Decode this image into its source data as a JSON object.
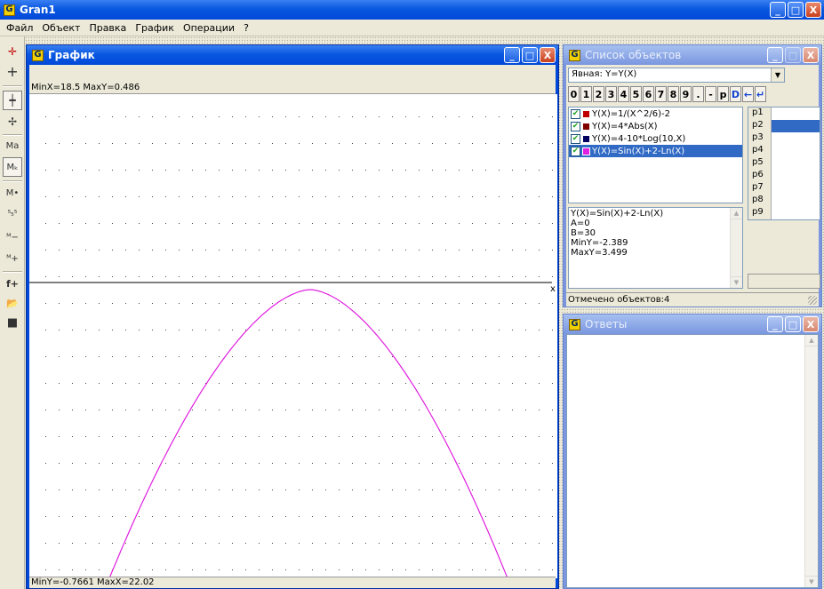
{
  "app": {
    "title": "Gran1"
  },
  "menu": [
    "Файл",
    "Объект",
    "Правка",
    "График",
    "Операции",
    "?"
  ],
  "window_buttons": {
    "minimize": "_",
    "maximize": "□",
    "close": "X"
  },
  "toolbar": {
    "items": [
      {
        "name": "axes-red-icon",
        "glyph": "✛"
      },
      {
        "name": "axes-icon",
        "glyph": "+"
      },
      {
        "name": "axes-move-icon",
        "glyph": "┿"
      },
      {
        "name": "axes-rotate-icon",
        "glyph": "✢"
      },
      {
        "name": "scale-a-icon",
        "glyph": "Ma"
      },
      {
        "name": "scale-k-icon",
        "glyph": "Mₖ"
      },
      {
        "name": "scale-point-icon",
        "glyph": "M•"
      },
      {
        "name": "scale-5-icon",
        "glyph": "⁵₅⁵"
      },
      {
        "name": "zoom-out-icon",
        "glyph": "ᴹ−"
      },
      {
        "name": "zoom-in-icon",
        "glyph": "ᴹ+"
      },
      {
        "name": "add-function-icon",
        "glyph": "f+"
      },
      {
        "name": "open-folder-icon",
        "glyph": "📂"
      },
      {
        "name": "save-icon",
        "glyph": "■"
      }
    ]
  },
  "graph_window": {
    "title": "График",
    "top_info": "MinX=18.5  MaxY=0.486",
    "bottom_info": "MinY=-0.7661  MaxX=22.02",
    "axis_label_x": "x",
    "curve_color": "#e020e0"
  },
  "objects_window": {
    "title": "Список объектов",
    "combo_value": "Явная: Y=Y(X)",
    "keys": [
      "0",
      "1",
      "2",
      "3",
      "4",
      "5",
      "6",
      "7",
      "8",
      "9",
      ".",
      "-",
      "p",
      "D",
      "←",
      "↵"
    ],
    "objects": [
      {
        "label": "Y(X)=1/(X^2/6)-2",
        "color": "#c00000",
        "checked": "✔",
        "selected": false
      },
      {
        "label": "Y(X)=4*Abs(X)",
        "color": "#800000",
        "checked": "✔",
        "selected": false
      },
      {
        "label": "Y(X)=4-10*Log(10,X)",
        "color": "#000060",
        "checked": "✔",
        "selected": false
      },
      {
        "label": "Y(X)=Sin(X)+2-Ln(X)",
        "color": "#e020e0",
        "checked": "✔",
        "selected": true
      }
    ],
    "params": [
      "p1",
      "p2",
      "p3",
      "p4",
      "p5",
      "p6",
      "p7",
      "p8",
      "p9"
    ],
    "selected_param": "p2",
    "info_lines": [
      "Y(X)=Sin(X)+2-Ln(X)",
      "A=0",
      "B=30",
      "MinY=-2.389",
      "MaxY=3.499"
    ],
    "status": "Отмечено объектов:4"
  },
  "answers_window": {
    "title": "Ответы"
  }
}
